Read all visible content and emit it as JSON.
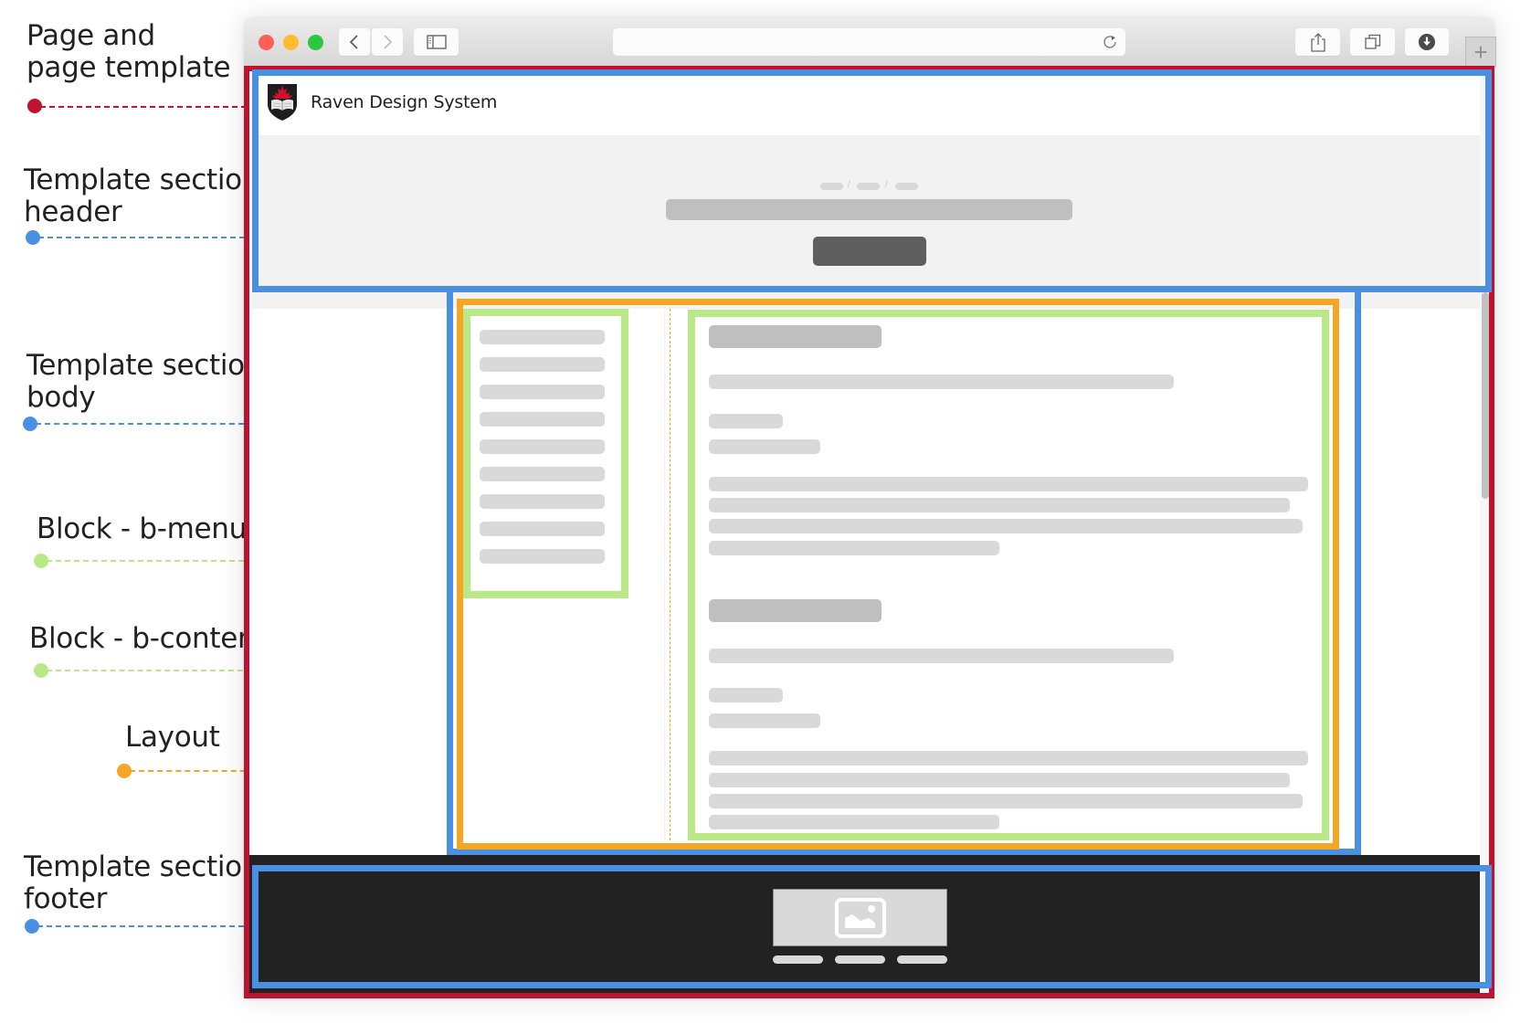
{
  "annotations": [
    {
      "id": "page",
      "label_lines": [
        "Page and",
        "page template"
      ],
      "color": "#be1230"
    },
    {
      "id": "header",
      "label_lines": [
        "Template section",
        "header"
      ],
      "color": "#4a90e2"
    },
    {
      "id": "body",
      "label_lines": [
        "Template section",
        "body"
      ],
      "color": "#4a90e2"
    },
    {
      "id": "b-menu",
      "label_lines": [
        "Block - b-menu"
      ],
      "color": "#b8e986"
    },
    {
      "id": "b-content",
      "label_lines": [
        "Block - b-content"
      ],
      "color": "#b8e986"
    },
    {
      "id": "layout",
      "label_lines": [
        "Layout"
      ],
      "color": "#f5a623"
    },
    {
      "id": "footer",
      "label_lines": [
        "Template section",
        "footer"
      ],
      "color": "#4a90e2"
    }
  ],
  "browser": {
    "address_bar_value": "",
    "icons": {
      "back": "chevron-left-icon",
      "forward": "chevron-right-icon",
      "sidebar": "sidebar-icon",
      "reload": "reload-icon",
      "share": "share-icon",
      "tabs": "tabs-overview-icon",
      "downloads": "download-icon",
      "new_tab": "plus-icon"
    }
  },
  "site": {
    "name": "Raven Design System",
    "logo_icon": "maple-leaf-shield-icon"
  },
  "hero": {
    "breadcrumb_count": 3,
    "breadcrumb_separator": "/"
  },
  "menu": {
    "item_count": 9
  },
  "footer": {
    "image_icon": "image-icon",
    "link_count": 3
  },
  "colors": {
    "page_frame": "#be1230",
    "template_section": "#4a90e2",
    "layout": "#f5a623",
    "block": "#b8e986",
    "footer_bg": "#222222",
    "placeholder_light": "#d9d9d9",
    "placeholder_mid": "#bfbfbf",
    "placeholder_dark": "#5f5f5f"
  }
}
